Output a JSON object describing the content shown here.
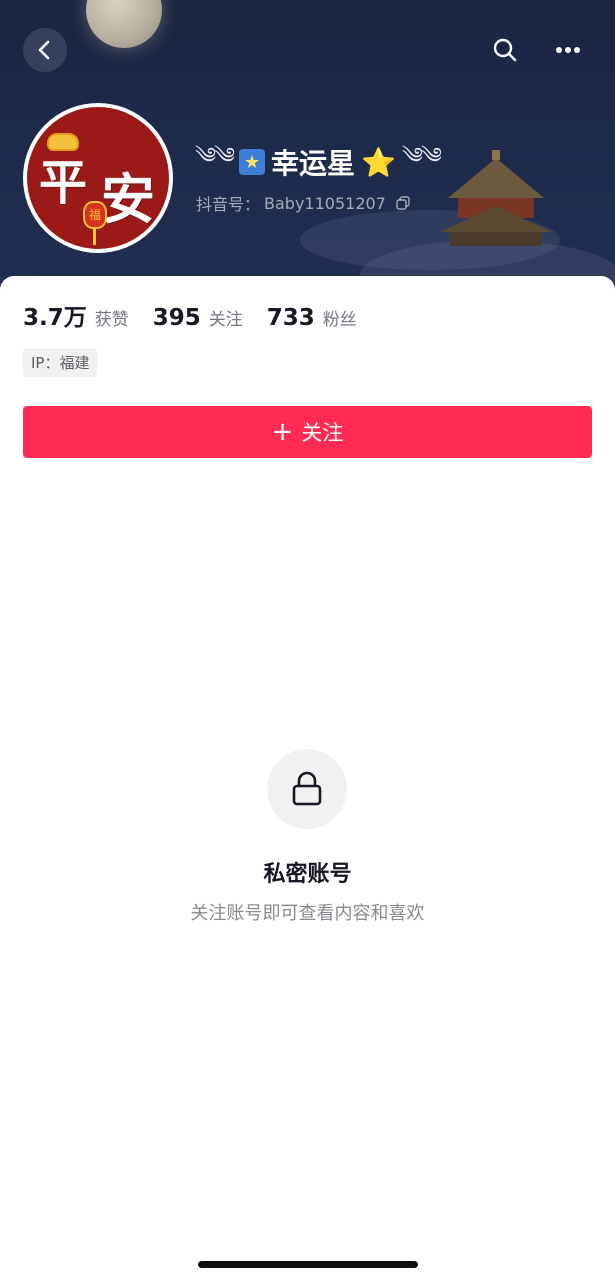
{
  "header": {
    "nickname_left_ornament": "༄༄",
    "nickname_icon": "★",
    "nickname": "幸运星",
    "nickname_star": "⭐",
    "nickname_right_ornament": "༄༄",
    "id_label": "抖音号：",
    "id_value": "Baby11051207",
    "avatar_text_1": "平",
    "avatar_text_2": "安",
    "avatar_lantern_text": "福"
  },
  "stats": [
    {
      "value": "3.7万",
      "label": "获赞"
    },
    {
      "value": "395",
      "label": "关注"
    },
    {
      "value": "733",
      "label": "粉丝"
    }
  ],
  "ip_tag": "IP：福建",
  "follow_button": {
    "icon": "+",
    "label": "关注"
  },
  "private": {
    "title": "私密账号",
    "subtitle": "关注账号即可查看内容和喜欢"
  },
  "colors": {
    "accent": "#fe2c55",
    "header_bg": "#1e2a4a",
    "avatar_bg": "#9b1a17"
  },
  "icons": [
    "back-arrow-icon",
    "search-icon",
    "more-icon",
    "copy-icon",
    "lock-icon"
  ]
}
